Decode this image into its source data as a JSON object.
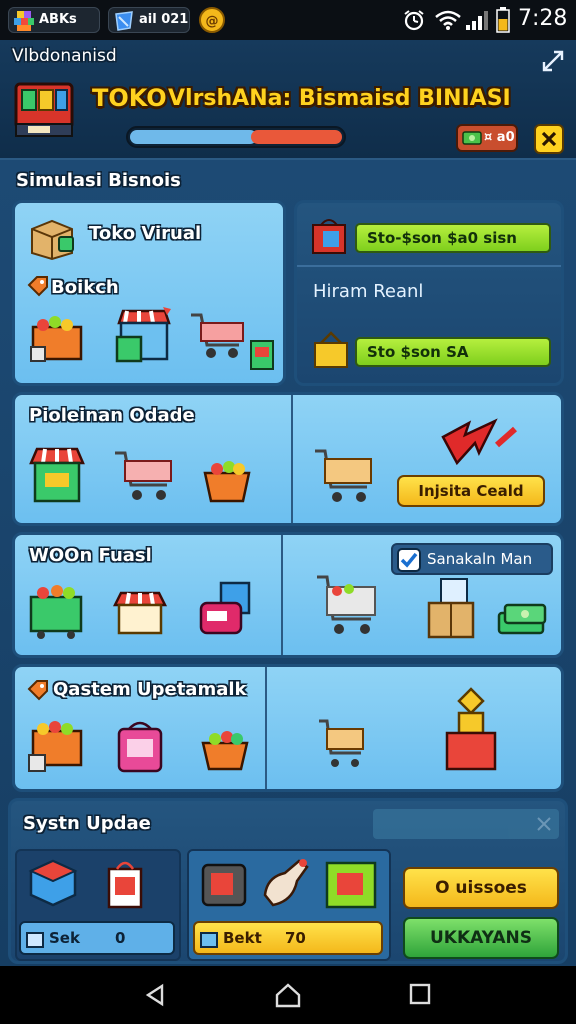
{
  "status_bar": {
    "pill_1": "ABKs",
    "pill_2": "ail 021",
    "time": "7:28"
  },
  "app_header": {
    "subtitle": "Vlbdonanisd",
    "title_prefix": "TOKO",
    "title_main": "VlrshANa: Bismaisd BINIASI",
    "progress": 0.6,
    "money": "¤ a0"
  },
  "sections": {
    "simulasi_label": "Simulasi Bisnois",
    "toko_virtual": "Toko Virual",
    "boikch": "Boikch",
    "sto_bar_1": "Sto-$son $a0 sisn",
    "hiram_reanl": "Hiram Reanl",
    "sto_bar_2": "Sto $son SA",
    "pioleinan": "Pioleinan Odade",
    "lanjutan_button": "Injsita Ceald",
    "woon_fuasl": "WOOn Fuasl",
    "sanakal_man": "Sanakaln Man",
    "qastem": "Qastem Upetamalk",
    "system_update": "Systn Updae",
    "sek": "Sek",
    "sek_value": "0",
    "bekt": "Bekt",
    "bekt_value": "70",
    "buy_button": "O uissoes",
    "next_button": "UKKAYANS"
  },
  "colors": {
    "accent_yellow": "#ffd21f",
    "panel_light": "#7cc8f2",
    "panel_dark": "#1e4a73",
    "bar_green": "#8fdc27",
    "progress_red": "#e9583a",
    "progress_blue": "#6fb9ea"
  },
  "icons": [
    "store-icon",
    "cash-icon",
    "cart-icon",
    "basket-icon",
    "box-icon",
    "alert-arrow-icon",
    "checkbox-icon",
    "shopping-bag-icon",
    "cube-icon"
  ]
}
